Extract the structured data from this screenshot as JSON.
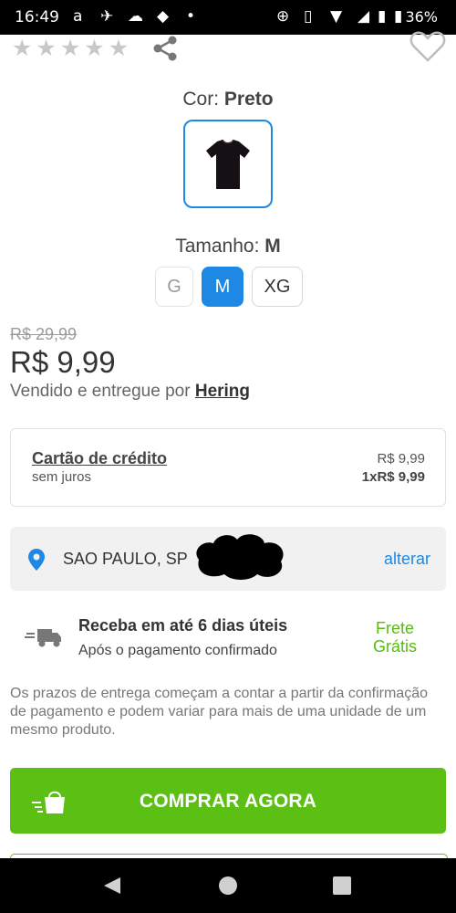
{
  "status_bar": {
    "time": "16:49",
    "battery": "36%",
    "icons": [
      "amazon-icon",
      "signature-icon",
      "brain-icon",
      "flame-icon",
      "dot-icon",
      "data-saver-icon",
      "vibrate-icon",
      "signal-icon",
      "wifi-icon",
      "network-icon",
      "battery-icon"
    ]
  },
  "product": {
    "rating_stars": 5,
    "color_label": "Cor:",
    "color_value": "Preto",
    "size_label": "Tamanho:",
    "size_value": "M",
    "sizes": [
      "G",
      "M",
      "XG"
    ],
    "selected_size": "M",
    "old_price": "R$ 29,99",
    "price": "R$ 9,99",
    "seller_prefix": "Vendido e entregue por",
    "seller_name": "Hering"
  },
  "payment": {
    "method": "Cartão de crédito",
    "note": "sem juros",
    "total": "R$ 9,99",
    "installment": "1xR$ 9,99"
  },
  "shipping": {
    "location": "SAO PAULO, SP",
    "change_label": "alterar",
    "delivery_title": "Receba em até 6 dias úteis",
    "delivery_sub": "Após o pagamento confirmado",
    "free_line1": "Frete",
    "free_line2": "Grátis",
    "disclaimer": "Os prazos de entrega começam a contar a partir da confirmação de pagamento e podem variar para mais de uma unidade de um mesmo produto."
  },
  "buy_button": {
    "label": "COMPRAR AGORA"
  },
  "colors": {
    "accent_blue": "#1e88e5",
    "buy_green": "#5cbf14",
    "free_shipping_green": "#57bb12"
  }
}
